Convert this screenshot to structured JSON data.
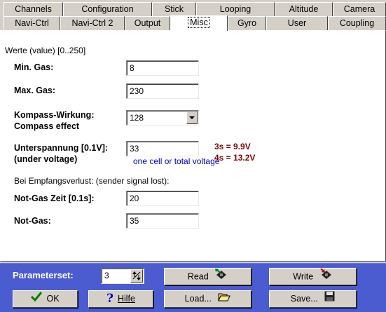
{
  "tabs_row1": [
    "Channels",
    "Configuration",
    "Stick",
    "Looping",
    "Altitude",
    "Camera"
  ],
  "tabs_row2": [
    "Navi-Ctrl",
    "Navi-Ctrl 2",
    "Output",
    "Misc",
    "Gyro",
    "User",
    "Coupling"
  ],
  "active_tab": "Misc",
  "misc": {
    "range_hint": "Werte (value) [0..250]",
    "min_gas": {
      "label": "Min. Gas:",
      "value": "8"
    },
    "max_gas": {
      "label": "Max. Gas:",
      "value": "230"
    },
    "compass": {
      "label1": "Kompass-Wirkung:",
      "label2": "Compass effect",
      "value": "128"
    },
    "undervoltage": {
      "label1": "Unterspannung [0.1V]:",
      "label2": "(under voltage)",
      "value": "33",
      "note": "one cell or total voltage",
      "info_3s": "3s = 9.9V",
      "info_4s": "4s = 13.2V"
    },
    "signal_lost_heading": "Bei Empfangsverlust: (sender signal lost):",
    "not_gas_zeit": {
      "label": "Not-Gas Zeit [0.1s]:",
      "value": "20"
    },
    "not_gas": {
      "label": "Not-Gas:",
      "value": "35"
    }
  },
  "bottom": {
    "parameterset_label": "Parameterset:",
    "parameterset_value": "3",
    "read_label": "Read",
    "write_label": "Write",
    "ok_label": "OK",
    "hilfe_label": "Hilfe",
    "load_label": "Load...",
    "save_label": "Save..."
  },
  "colors": {
    "bottom_bar": "#4a5cd0",
    "note_blue": "#0000c0",
    "info_darkred": "#800000",
    "ok_check_green": "#008000",
    "help_blue": "#0000c0"
  }
}
